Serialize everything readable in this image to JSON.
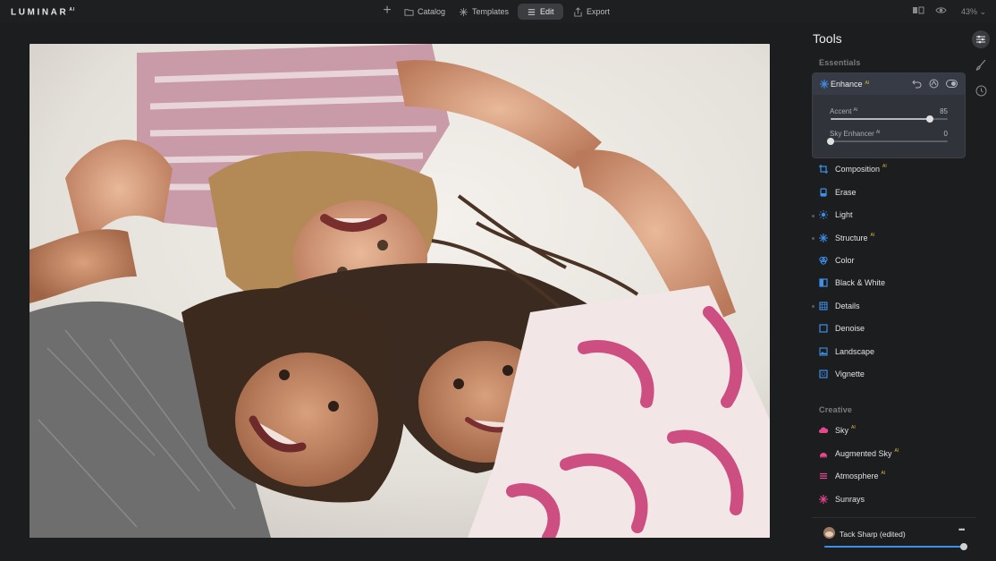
{
  "app": {
    "logo": "LUMINAR",
    "logo_suffix": "AI"
  },
  "topnav": {
    "catalog": "Catalog",
    "templates": "Templates",
    "edit": "Edit",
    "export": "Export",
    "zoom": "43%"
  },
  "panel": {
    "title": "Tools",
    "essentials_label": "Essentials",
    "creative_label": "Creative",
    "enhance": {
      "label": "Enhance",
      "ai": "AI",
      "accent_label": "Accent",
      "accent_value": "85",
      "accent_fraction": 0.85,
      "sky_label": "Sky Enhancer",
      "sky_value": "0",
      "sky_fraction": 0.0
    },
    "essentials_tools": [
      {
        "label": "Composition",
        "ai": "AI",
        "icon": "crop-icon"
      },
      {
        "label": "Erase",
        "ai": "",
        "icon": "eraser-icon"
      },
      {
        "label": "Light",
        "ai": "",
        "icon": "sun-icon"
      },
      {
        "label": "Structure",
        "ai": "AI",
        "icon": "structure-icon"
      },
      {
        "label": "Color",
        "ai": "",
        "icon": "color-circles-icon"
      },
      {
        "label": "Black & White",
        "ai": "",
        "icon": "half-square-icon"
      },
      {
        "label": "Details",
        "ai": "",
        "icon": "grid-icon"
      },
      {
        "label": "Denoise",
        "ai": "",
        "icon": "denoise-icon"
      },
      {
        "label": "Landscape",
        "ai": "",
        "icon": "landscape-icon"
      },
      {
        "label": "Vignette",
        "ai": "",
        "icon": "vignette-icon"
      }
    ],
    "creative_tools": [
      {
        "label": "Sky",
        "ai": "AI",
        "icon": "cloud-icon"
      },
      {
        "label": "Augmented Sky",
        "ai": "AI",
        "icon": "augmented-sky-icon"
      },
      {
        "label": "Atmosphere",
        "ai": "AI",
        "icon": "atmosphere-icon"
      },
      {
        "label": "Sunrays",
        "ai": "",
        "icon": "sunrays-icon"
      }
    ],
    "preset": {
      "label": "Tack Sharp (edited)",
      "amount_fraction": 1.0,
      "more": "•••"
    }
  },
  "colors": {
    "accent": "#3d8fe8",
    "ai_badge": "#e2b640",
    "creative_pink": "#e8458f"
  }
}
